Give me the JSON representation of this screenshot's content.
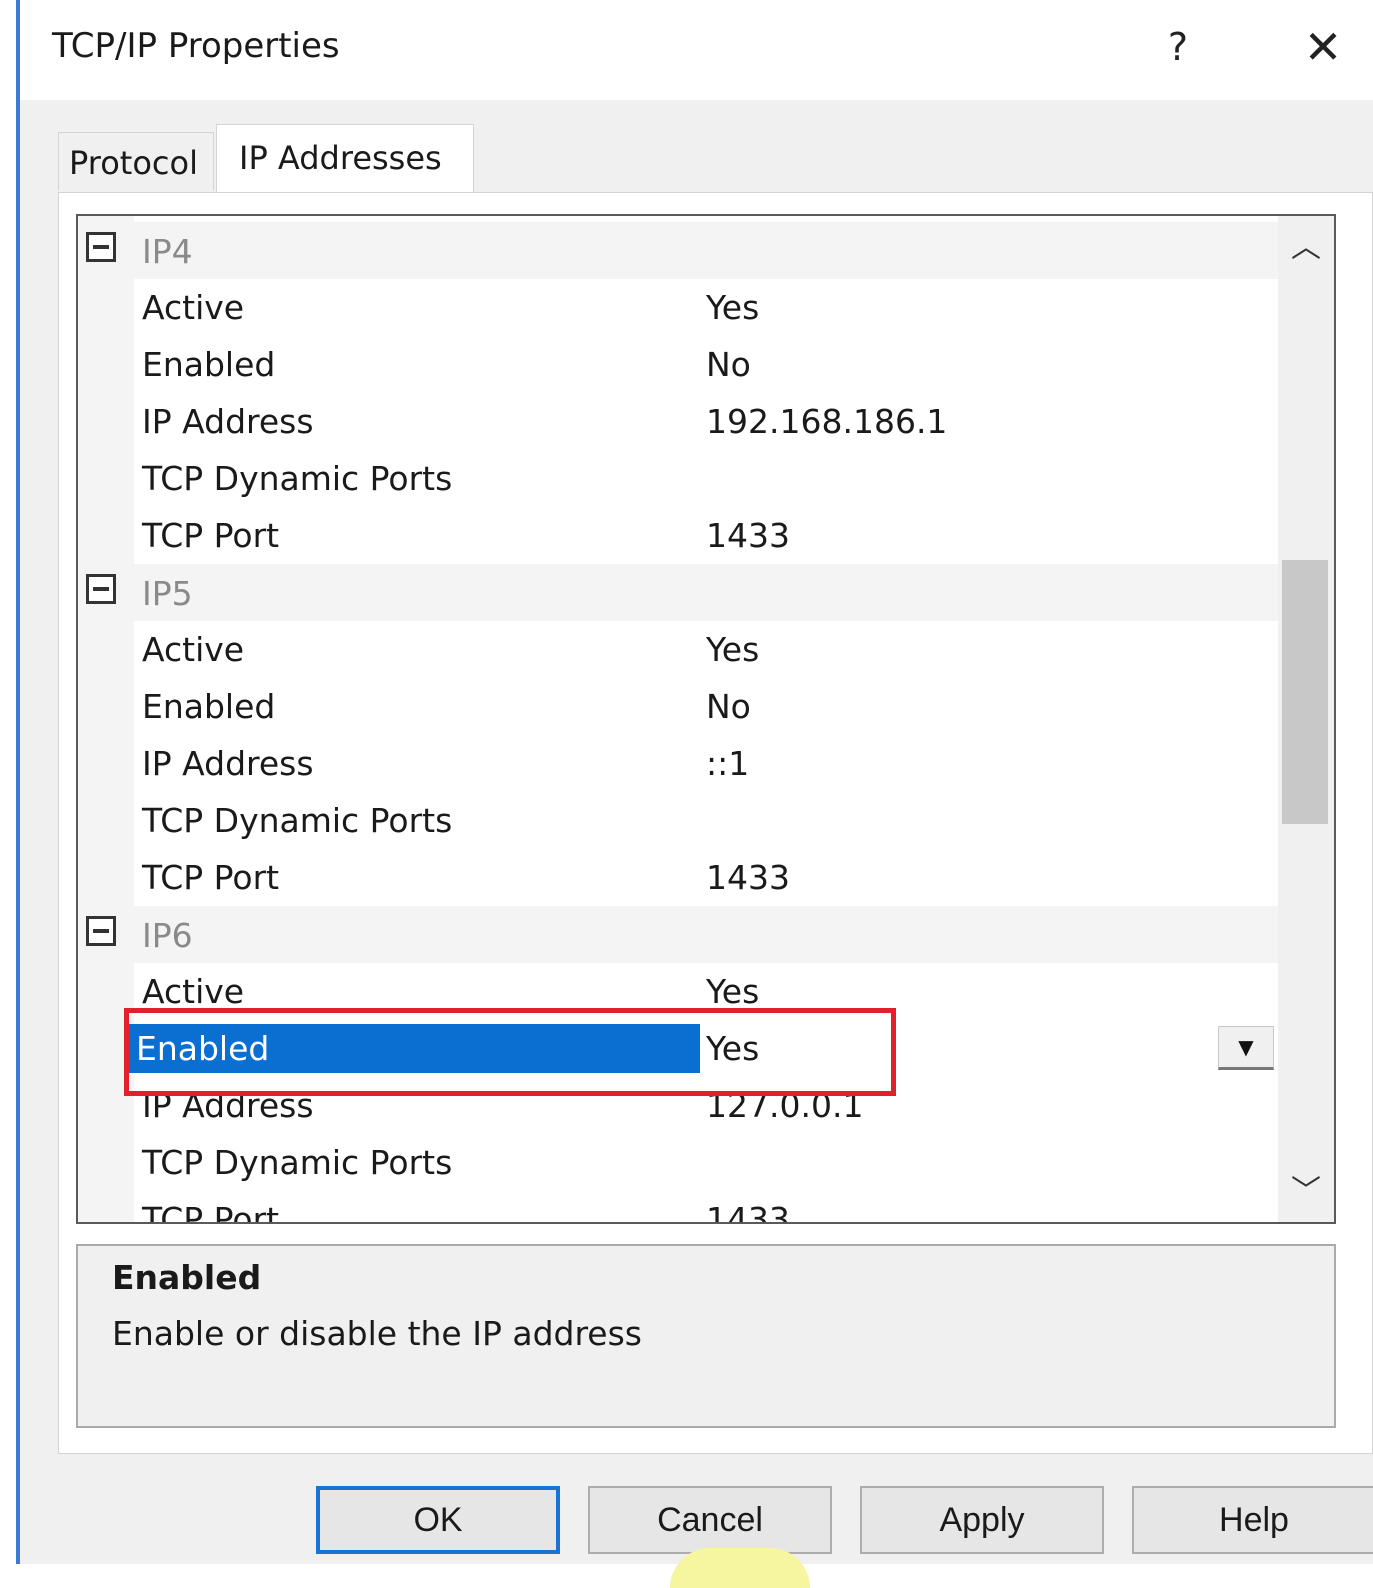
{
  "dialog": {
    "title": "TCP/IP Properties",
    "help_label": "?",
    "close_label": "✕"
  },
  "tabs": [
    {
      "label": "Protocol",
      "selected": false
    },
    {
      "label": "IP Addresses",
      "selected": true
    }
  ],
  "property_grid": {
    "categories": [
      {
        "name": "IP4",
        "properties": [
          {
            "name": "Active",
            "value": "Yes"
          },
          {
            "name": "Enabled",
            "value": "No"
          },
          {
            "name": "IP Address",
            "value": "192.168.186.1"
          },
          {
            "name": "TCP Dynamic Ports",
            "value": ""
          },
          {
            "name": "TCP Port",
            "value": "1433"
          }
        ]
      },
      {
        "name": "IP5",
        "properties": [
          {
            "name": "Active",
            "value": "Yes"
          },
          {
            "name": "Enabled",
            "value": "No"
          },
          {
            "name": "IP Address",
            "value": "::1"
          },
          {
            "name": "TCP Dynamic Ports",
            "value": ""
          },
          {
            "name": "TCP Port",
            "value": "1433"
          }
        ]
      },
      {
        "name": "IP6",
        "properties": [
          {
            "name": "Active",
            "value": "Yes"
          },
          {
            "name": "Enabled",
            "value": "Yes",
            "selected": true
          },
          {
            "name": "IP Address",
            "value": "127.0.0.1"
          },
          {
            "name": "TCP Dynamic Ports",
            "value": ""
          },
          {
            "name": "TCP Port",
            "value": "1433"
          }
        ]
      }
    ],
    "dropdown_icon": "dropdown-arrow-icon",
    "scroll_up_icon": "chevron-up-icon",
    "scroll_down_icon": "chevron-down-icon"
  },
  "description": {
    "title": "Enabled",
    "text": "Enable or disable the IP address"
  },
  "buttons": {
    "ok": "OK",
    "cancel": "Cancel",
    "apply": "Apply",
    "help": "Help"
  },
  "colors": {
    "selection": "#0a6fd1",
    "highlight_box": "#e0202a",
    "default_button_border": "#1a72d1"
  }
}
